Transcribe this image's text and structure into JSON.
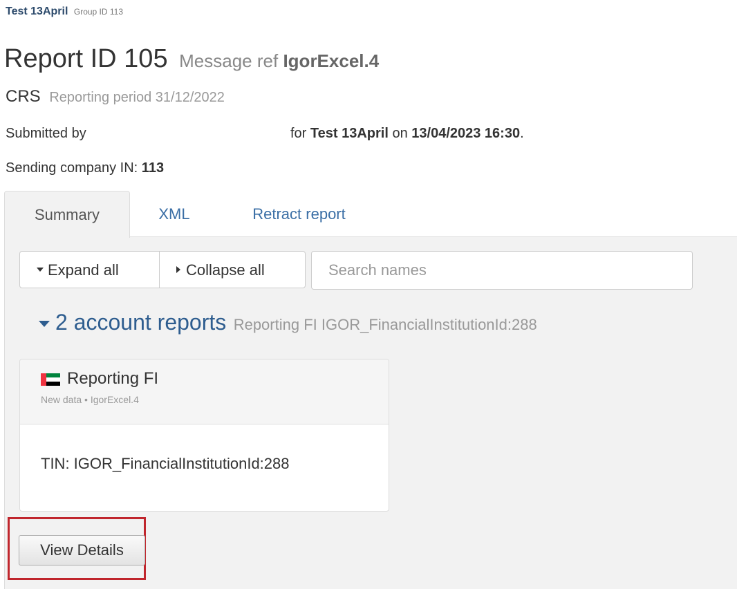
{
  "header": {
    "company_name": "Test 13April",
    "group_id": "Group ID 113",
    "report_label": "Report ID 105",
    "message_ref_label": "Message ref",
    "message_ref_value": "IgorExcel.4",
    "regime": "CRS",
    "reporting_period": "Reporting period 31/12/2022",
    "submitted_by_label": "Submitted by",
    "for_label": "for",
    "for_company": "Test 13April",
    "on_label": "on",
    "submitted_at": "13/04/2023 16:30",
    "submitted_end": ".",
    "sending_company_label": "Sending company IN:",
    "sending_company_value": "113"
  },
  "tabs": [
    {
      "label": "Summary",
      "active": true
    },
    {
      "label": "XML",
      "active": false
    },
    {
      "label": "Retract report",
      "active": false
    }
  ],
  "toolbar": {
    "expand_label": "Expand all",
    "collapse_label": "Collapse all",
    "search_placeholder": "Search names",
    "search_value": ""
  },
  "section": {
    "title": "2 account reports",
    "subtitle": "Reporting FI IGOR_FinancialInstitutionId:288"
  },
  "card": {
    "flag_icon": "uae-flag-icon",
    "title": "Reporting FI",
    "meta": "New data • IgorExcel.4",
    "tin": "TIN: IGOR_FinancialInstitutionId:288"
  },
  "actions": {
    "view_details_label": "View Details"
  },
  "colors": {
    "link": "#3a6ea5",
    "section_title": "#2e5d8f",
    "highlight": "#c0262d",
    "panel_bg": "#f2f2f2"
  }
}
